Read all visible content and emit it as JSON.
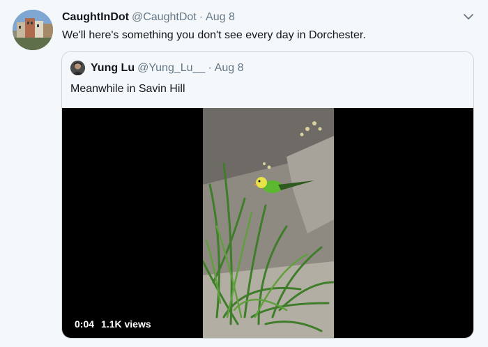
{
  "tweet": {
    "name": "CaughtInDot",
    "handle": "@CaughtDot",
    "separator": "·",
    "date": "Aug 8",
    "text": "We'll here's something you don't see every day in Dorchester.",
    "caret_icon": "chevron-down-icon",
    "avatar_icon": "city-houses-photo"
  },
  "quoted": {
    "name": "Yung Lu",
    "handle": "@Yung_Lu__",
    "separator": "·",
    "date": "Aug 8",
    "text": "Meanwhile in Savin Hill",
    "avatar_icon": "person-photo",
    "video": {
      "time": "0:04",
      "views": "1.1K views",
      "subject": "green-parakeet-in-grass"
    }
  },
  "colors": {
    "background": "#f5f8fa",
    "text_primary": "#14171a",
    "text_secondary": "#657786",
    "border": "#ccd6dd",
    "video_bg": "#000000"
  }
}
